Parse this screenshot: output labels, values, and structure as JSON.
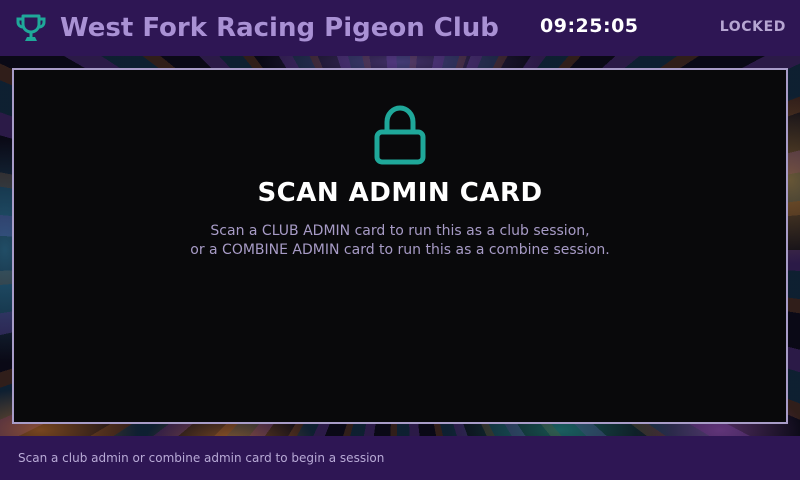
{
  "header": {
    "title": "West Fork Racing Pigeon Club",
    "clock": "09:25:05",
    "status": "LOCKED",
    "icon": "trophy-icon"
  },
  "main": {
    "icon": "lock-icon",
    "heading": "SCAN ADMIN CARD",
    "description_line1": "Scan a CLUB ADMIN card to run this as a club session,",
    "description_line2": "or a COMBINE ADMIN card to run this as a combine session."
  },
  "footer": {
    "hint": "Scan a club admin or combine admin card to begin a session"
  },
  "colors": {
    "bar_background": "#2e1654",
    "title": "#a991d4",
    "accent_teal": "#1fa89a",
    "panel_background": "#09090b",
    "panel_border": "#a89cc8"
  }
}
